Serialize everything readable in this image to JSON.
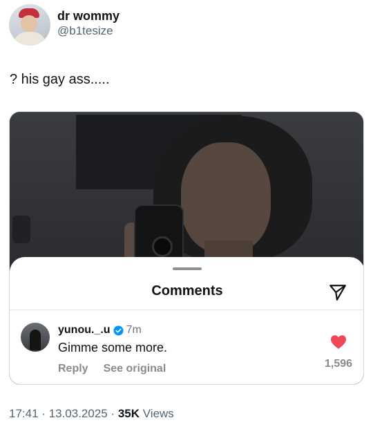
{
  "tweet": {
    "author": {
      "display_name": "dr wommy",
      "handle": "@b1tesize"
    },
    "text": "? his gay ass.....",
    "timestamp": "17:41 · 13.03.2025 · ",
    "views_count": "35K",
    "views_label": " Views"
  },
  "embedded_screenshot": {
    "sheet_title": "Comments",
    "comment": {
      "username": "yunou._.u",
      "time": "7m",
      "text": "Gimme some more.",
      "reply_label": "Reply",
      "see_original_label": "See original",
      "like_count": "1,596"
    }
  },
  "icons": {
    "send": "paper-plane-icon",
    "verified": "verified-badge-icon",
    "like": "heart-icon"
  },
  "colors": {
    "heart": "#ed4956",
    "verified": "#0095f6",
    "secondary_text": "#536471"
  }
}
